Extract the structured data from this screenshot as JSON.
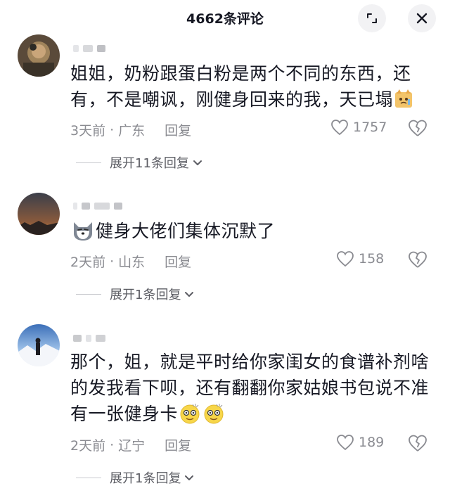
{
  "header": {
    "title": "4662条评论",
    "expand_icon": "expand-icon",
    "close_icon": "close-icon"
  },
  "comments": [
    {
      "text_parts": [
        "姐姐，奶粉跟蛋白粉是两个不同的东西，还有，不是嘲讽，刚健身回来的我，天已塌"
      ],
      "emoji_trailing": "crying-cat-emoji",
      "time": "3天前",
      "location": "广东",
      "reply_label": "回复",
      "likes": "1757",
      "expand_label": "展开11条回复"
    },
    {
      "emoji_leading": "husky-emoji",
      "text_parts": [
        "健身大佬们集体沉默了"
      ],
      "time": "2天前",
      "location": "山东",
      "reply_label": "回复",
      "likes": "158",
      "expand_label": "展开1条回复"
    },
    {
      "text_parts": [
        "那个，姐，就是平时给你家闺女的食谱补剂啥的发我看下呗，还有翻翻你家姑娘书包说不准有一张健身卡"
      ],
      "emoji_trailing": "dizzy-face-emoji",
      "time": "2天前",
      "location": "辽宁",
      "reply_label": "回复",
      "likes": "189",
      "expand_label": "展开1条回复"
    }
  ],
  "colors": {
    "text": "#161823",
    "meta": "#8a8b91",
    "expand": "#5b5c63",
    "button_bg": "#f2f2f4"
  }
}
